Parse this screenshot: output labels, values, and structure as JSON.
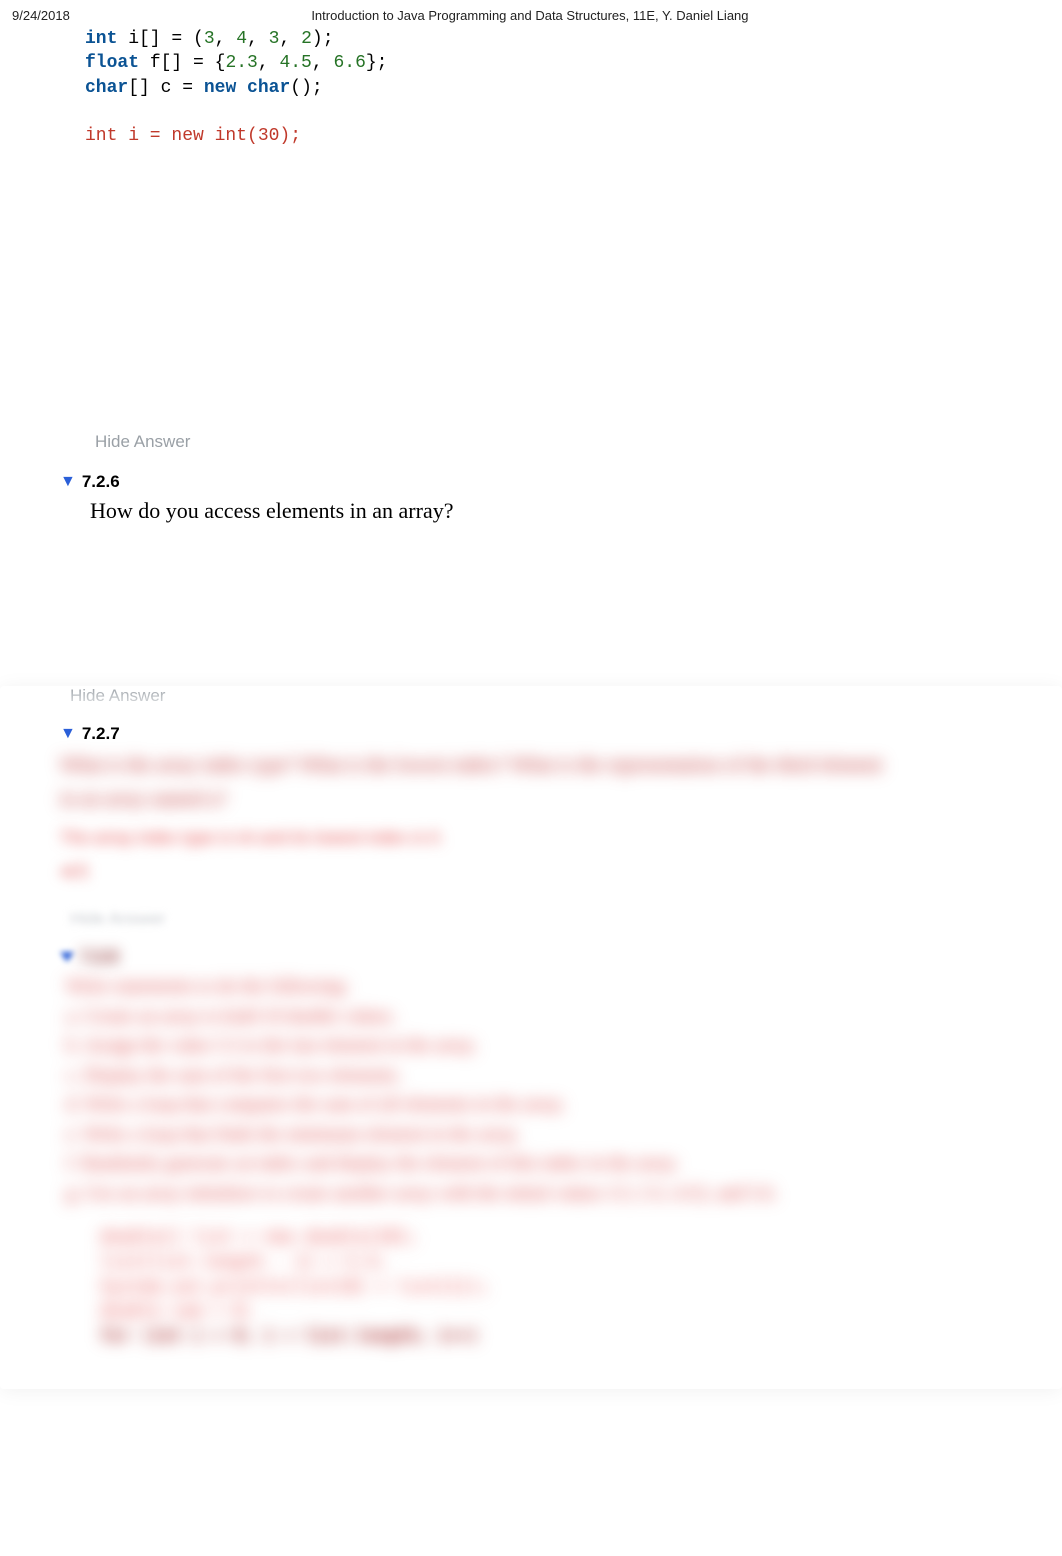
{
  "header": {
    "date": "9/24/2018",
    "title": "Introduction to Java Programming and Data Structures, 11E, Y. Daniel Liang"
  },
  "code": {
    "line1": {
      "kw": "int",
      "text": " i[] = (",
      "n1": "3",
      "c1": ", ",
      "n2": "4",
      "c2": ", ",
      "n3": "3",
      "c3": ", ",
      "n4": "2",
      "end": ");"
    },
    "line2": {
      "kw": "float",
      "text": " f[] = {",
      "n1": "2.3",
      "c1": ", ",
      "n2": "4.5",
      "c2": ", ",
      "n3": "6.6",
      "end": "};"
    },
    "line3": {
      "kw1": "char",
      "text1": "[] c = ",
      "kw2": "new char",
      "end": "();"
    },
    "line4": "int i = new int(30);"
  },
  "buttons": {
    "hide_answer": "Hide Answer"
  },
  "questions": {
    "q6": {
      "number": "7.2.6",
      "text": "How do you access elements in an array?"
    },
    "q7": {
      "number": "7.2.7"
    }
  },
  "blurred": {
    "q7_line1": "What is the array index type? What is the lowest index? What is the representation of the third element",
    "q7_line2": "in an array named a?",
    "q7_answer": "The array index type is int and its lowest index is 0.",
    "q7_short": "a[2]",
    "hide": "Hide Answer",
    "q8_num": "7.2.8",
    "q8_body_1": "Write statements to do the following:",
    "q8_body_2": "a. Create an array to hold 10 double values.",
    "q8_body_3": "b. Assign the value 5.5 to the last element in the array.",
    "q8_body_4": "c. Display the sum of the first two elements.",
    "q8_body_5": "d. Write a loop that computes the sum of all elements in the array.",
    "q8_body_6": "e. Write a loop that finds the minimum element in the array.",
    "q8_body_7": "f. Randomly generate an index and display the element of this index in the array.",
    "q8_body_8": "g. Use an array initializer to create another array with the initial values 3.5, 5.5, 4.52, and 5.6.",
    "code1": "double[] list = new double[10];",
    "code2": "list[list.length - 1] = 5.5;",
    "code3": "System.out.println(list[0] + list[1]);",
    "code4": "double sum = 0;",
    "code5": "for (int i = 0; i < list.length; i++)"
  }
}
